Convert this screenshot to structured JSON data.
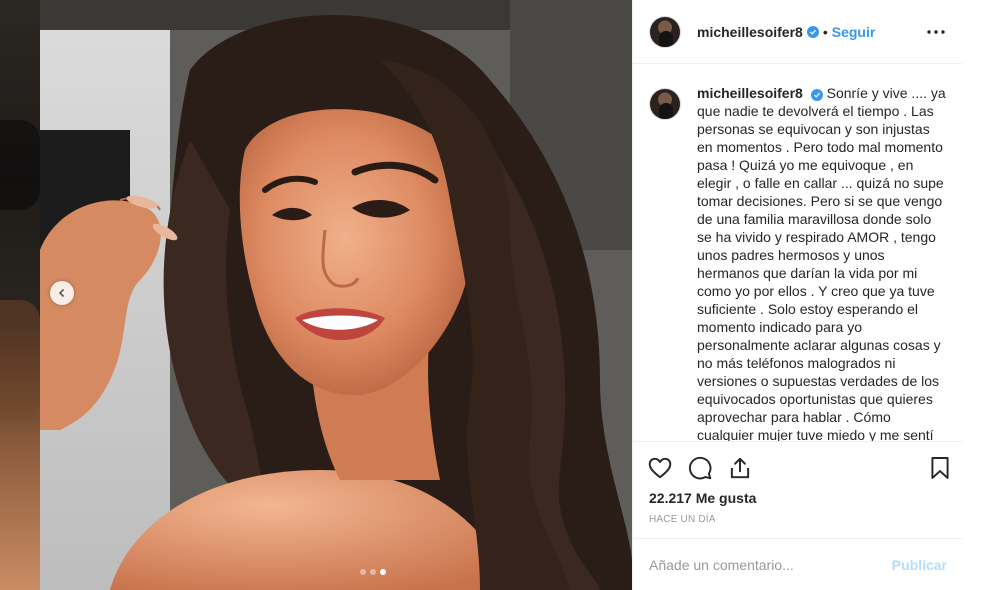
{
  "post": {
    "username": "micheillesoifer8",
    "separator": "•",
    "follow_label": "Seguir",
    "more_icon": "more-options-icon",
    "caption": "Sonríe y vive .... ya que nadie te devolverá el tiempo . Las personas se equivocan y son injustas en momentos . Pero todo mal momento pasa ! Quizá yo me equivoque , en elegir , o falle en callar ... quizá no supe tomar decisiones. Pero si se que vengo de una familia maravillosa donde solo se ha vivido y respirado AMOR , tengo unos padres hermosos y unos hermanos que darían la vida por mi como yo por ellos . Y creo que ya tuve suficiente . Solo estoy esperando el momento indicado para yo personalmente aclarar algunas cosas y no más teléfonos malogrados ni versiones o supuestas verdades de los equivocados oportunistas que quieres aprovechar para hablar . Cómo cualquier mujer tuve miedo y me sentí sola",
    "likes": "22.217 Me gusta",
    "time": "HACE UN DÍA"
  },
  "carousel": {
    "total": 3,
    "active_index": 2
  },
  "comment": {
    "placeholder": "Añade un comentario...",
    "publish_label": "Publicar"
  },
  "colors": {
    "accent": "#3897f0",
    "publish_disabled": "#b2dffc",
    "muted": "#999999",
    "text": "#262626"
  }
}
